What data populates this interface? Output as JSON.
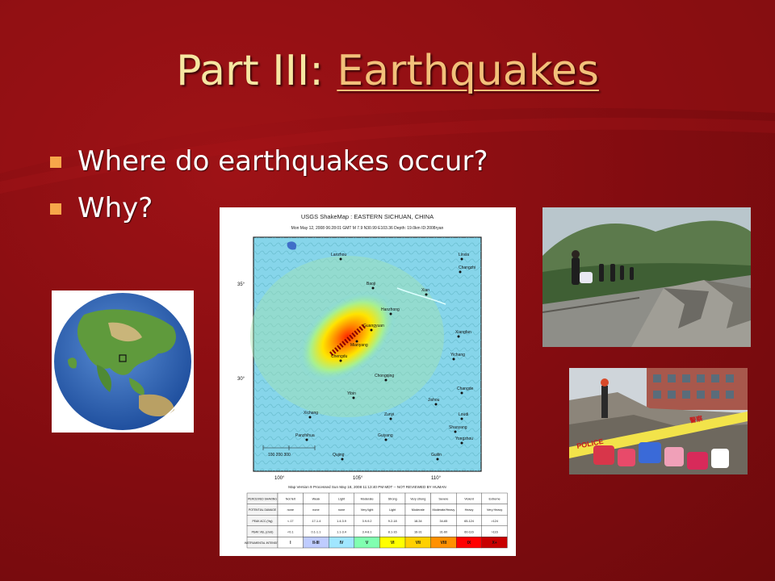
{
  "slide": {
    "title_prefix": "Part III: ",
    "title_link": "Earthquakes",
    "bullets": [
      "Where do earthquakes occur?",
      "Why?"
    ],
    "colors": {
      "background": "#8b0e12",
      "title": "#f6e6a2",
      "link": "#f2c07a",
      "bullet": "#f7a64a"
    }
  },
  "shakemap": {
    "title": "USGS ShakeMap : EASTERN SICHUAN, CHINA",
    "subtitle": "Mon May 12, 2008 06:28:01 GMT   M 7.9   N30.99 E103.36   Depth: 19.0km   ID:2008ryan",
    "footer": "Map Version 9 Processed Sun May 18, 2008 11:13:40 PM MDT -- NOT REVIEWED BY HUMAN",
    "lat_labels": [
      "35°",
      "30°"
    ],
    "lon_labels": [
      "100°",
      "105°",
      "110°"
    ],
    "cities": [
      "Lanzhou",
      "Linxia",
      "Changzhi",
      "Baoji",
      "Xian",
      "Hanzhong",
      "Guangyuan",
      "Mianyang",
      "Chengdu",
      "Xiangfan",
      "Yichang",
      "Chongqing",
      "Yibin",
      "Changde",
      "Jishou",
      "Xichang",
      "Zunyi",
      "Loudi",
      "Shaoyang",
      "Panzhihua",
      "Guiyang",
      "Yongzhou",
      "Qujing",
      "Guilin"
    ],
    "scale_label": "100  200  300",
    "legend": {
      "row_headers": [
        "PERCEIVED SHAKING",
        "POTENTIAL DAMAGE",
        "PEAK ACC.(%g)",
        "PEAK VEL.(cm/s)",
        "INSTRUMENTAL INTENSITY"
      ],
      "columns": [
        {
          "shaking": "Not felt",
          "damage": "none",
          "acc": "<.17",
          "vel": "<0.1",
          "intensity": "I",
          "color": "#ffffff"
        },
        {
          "shaking": "Weak",
          "damage": "none",
          "acc": ".17-1.4",
          "vel": "0.1-1.1",
          "intensity": "II-III",
          "color": "#bfccff"
        },
        {
          "shaking": "Light",
          "damage": "none",
          "acc": "1.4-3.9",
          "vel": "1.1-3.4",
          "intensity": "IV",
          "color": "#a0e6ff"
        },
        {
          "shaking": "Moderate",
          "damage": "Very light",
          "acc": "3.9-9.2",
          "vel": "3.4-8.1",
          "intensity": "V",
          "color": "#80ffb0"
        },
        {
          "shaking": "Strong",
          "damage": "Light",
          "acc": "9.2-18",
          "vel": "8.1-16",
          "intensity": "VI",
          "color": "#ffff00"
        },
        {
          "shaking": "Very strong",
          "damage": "Moderate",
          "acc": "18-34",
          "vel": "16-31",
          "intensity": "VII",
          "color": "#ffd000"
        },
        {
          "shaking": "Severe",
          "damage": "Moderate/Heavy",
          "acc": "34-65",
          "vel": "31-60",
          "intensity": "VIII",
          "color": "#ff9000"
        },
        {
          "shaking": "Violent",
          "damage": "Heavy",
          "acc": "65-124",
          "vel": "60-116",
          "intensity": "IX",
          "color": "#ff0000"
        },
        {
          "shaking": "Extreme",
          "damage": "Very Heavy",
          "acc": ">124",
          "vel": ">116",
          "intensity": "X+",
          "color": "#c80000"
        }
      ]
    }
  },
  "rubble_photo": {
    "tape_text": "POLICE",
    "tape_text_chinese": "警察"
  }
}
